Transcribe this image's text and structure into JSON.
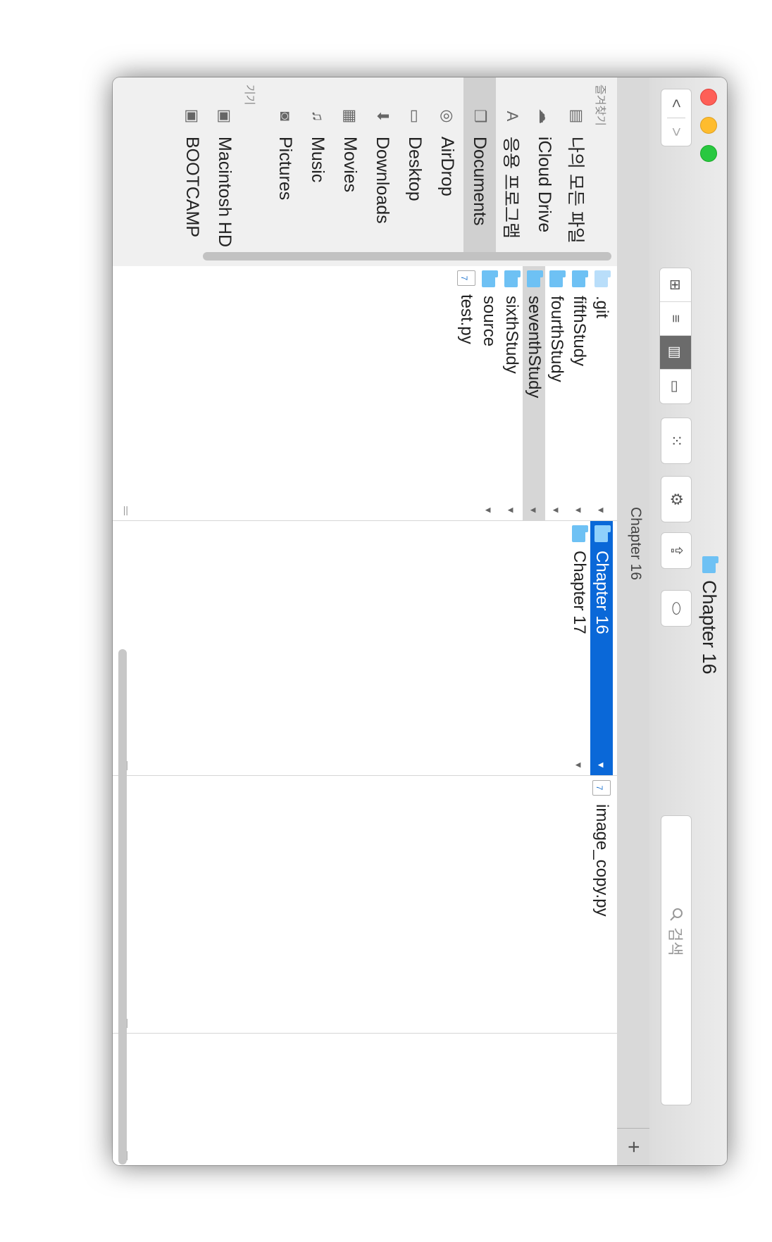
{
  "window": {
    "title": "Chapter 16"
  },
  "toolbar": {
    "back_label": "<",
    "forward_label": ">",
    "view_icons_label": "⊞",
    "view_list_label": "≡",
    "view_columns_label": "▥",
    "view_gallery_label": "▭",
    "arrange_label": "⁙",
    "action_label": "⚙",
    "share_label": "⇪",
    "tag_label": "⬭",
    "search_placeholder": "검색"
  },
  "pathbar": {
    "title": "Chapter 16",
    "add_label": "+"
  },
  "sidebar": {
    "favorites_heading": "즐겨찾기",
    "devices_heading": "기기",
    "favorites": [
      {
        "label": "나의 모든 파일",
        "icon": "all-files-icon"
      },
      {
        "label": "iCloud Drive",
        "icon": "cloud-icon"
      },
      {
        "label": "응용 프로그램",
        "icon": "applications-icon"
      },
      {
        "label": "Documents",
        "icon": "documents-icon",
        "selected": true
      },
      {
        "label": "AirDrop",
        "icon": "airdrop-icon"
      },
      {
        "label": "Desktop",
        "icon": "desktop-icon"
      },
      {
        "label": "Downloads",
        "icon": "downloads-icon"
      },
      {
        "label": "Movies",
        "icon": "movies-icon"
      },
      {
        "label": "Music",
        "icon": "music-icon"
      },
      {
        "label": "Pictures",
        "icon": "pictures-icon"
      }
    ],
    "devices": [
      {
        "label": "Macintosh HD",
        "icon": "disk-icon"
      },
      {
        "label": "BOOTCAMP",
        "icon": "disk-icon"
      }
    ]
  },
  "columns": [
    {
      "items": [
        {
          "name": ".git",
          "kind": "folder-light",
          "arrow": "▼"
        },
        {
          "name": "fifthStudy",
          "kind": "folder",
          "arrow": "▼"
        },
        {
          "name": "fourthStudy",
          "kind": "folder",
          "arrow": "▼"
        },
        {
          "name": "seventhStudy",
          "kind": "folder",
          "arrow": "▼",
          "selected": true
        },
        {
          "name": "sixthStudy",
          "kind": "folder",
          "arrow": "▼"
        },
        {
          "name": "source",
          "kind": "folder",
          "arrow": "▼"
        },
        {
          "name": "test.py",
          "kind": "python"
        }
      ]
    },
    {
      "items": [
        {
          "name": "Chapter 16",
          "kind": "folder",
          "arrow": "▼",
          "active": true
        },
        {
          "name": "Chapter 17",
          "kind": "folder",
          "arrow": "▼"
        }
      ]
    },
    {
      "items": [
        {
          "name": "image_copy.py",
          "kind": "python"
        }
      ]
    }
  ],
  "colors": {
    "selection": "#0a68d8",
    "folder": "#6ec1f4"
  }
}
